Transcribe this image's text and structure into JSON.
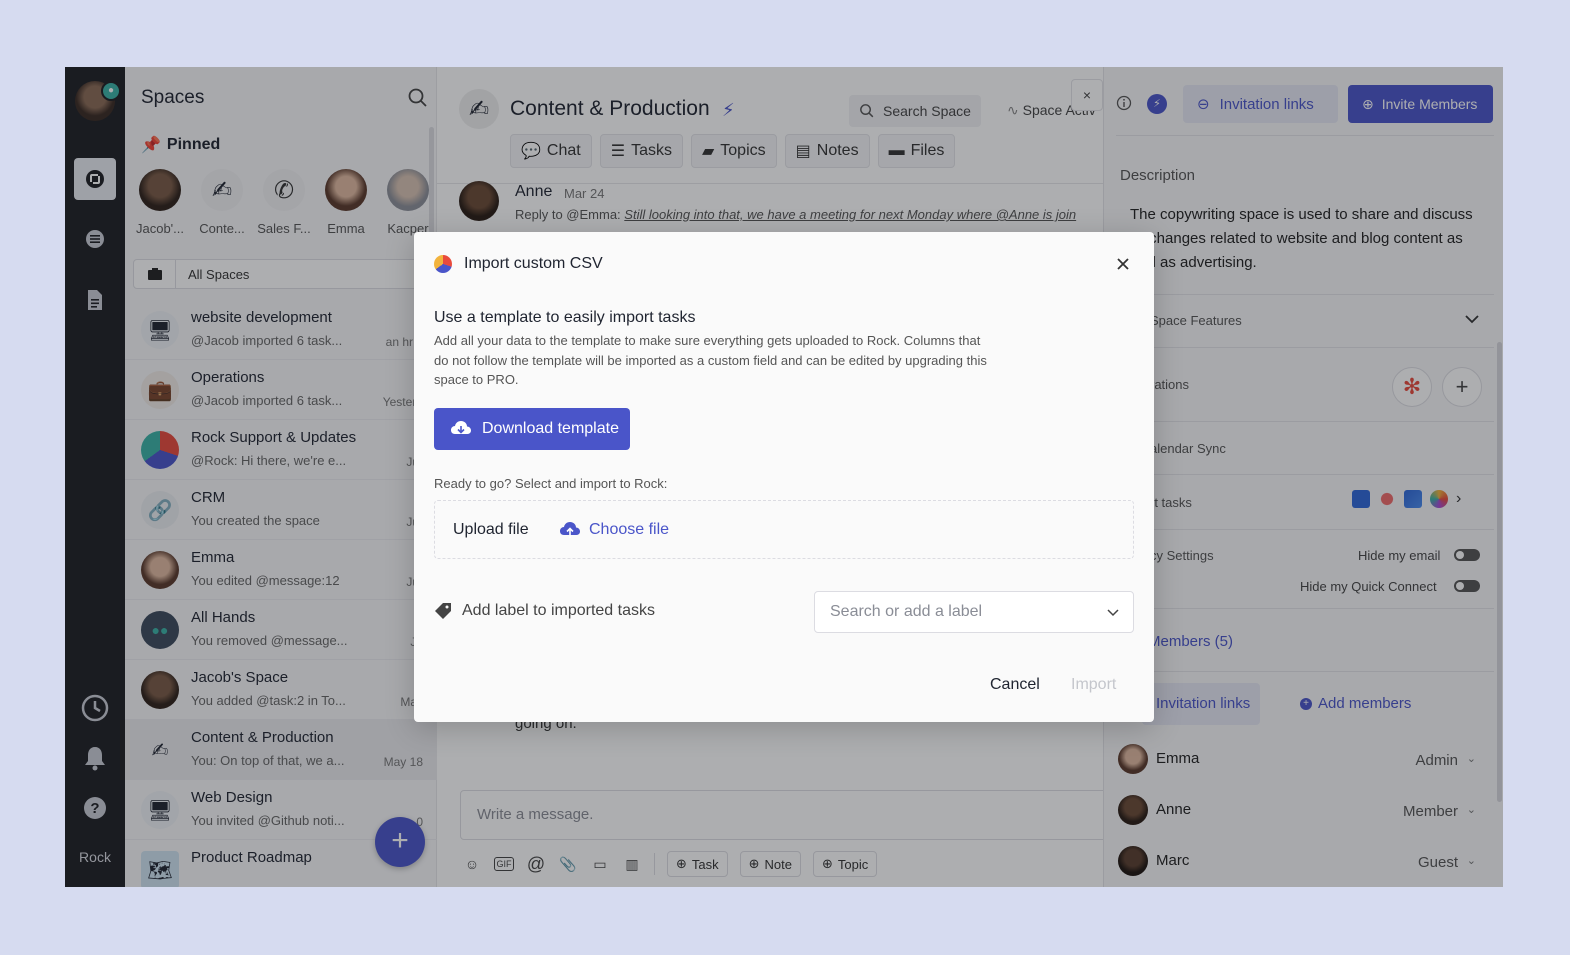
{
  "rail": {
    "label": "Rock"
  },
  "sidebar": {
    "title": "Spaces",
    "pinned_heading": "Pinned",
    "pins": [
      {
        "label": "Jacob'..."
      },
      {
        "label": "Conte..."
      },
      {
        "label": "Sales F..."
      },
      {
        "label": "Emma"
      },
      {
        "label": "Kacper"
      }
    ],
    "filter": "All Spaces",
    "spaces": [
      {
        "name": "website development",
        "sub": "@Jacob imported 6 task...",
        "time": "an hr a"
      },
      {
        "name": "Operations",
        "sub": "@Jacob imported 6 task...",
        "time": "Yesterd"
      },
      {
        "name": "Rock Support & Updates",
        "sub": "@Rock: Hi there, we're e...",
        "time": "Jur"
      },
      {
        "name": "CRM",
        "sub": "You created the space",
        "time": "Jur"
      },
      {
        "name": "Emma",
        "sub": "You edited @message:12",
        "time": "Jur"
      },
      {
        "name": "All Hands",
        "sub": "You removed @message...",
        "time": "Ju"
      },
      {
        "name": "Jacob's Space",
        "sub": "You added @task:2 in To...",
        "time": "May"
      },
      {
        "name": "Content & Production",
        "sub": "You: On top of that, we a...",
        "time": "May 18"
      },
      {
        "name": "Web Design",
        "sub": "You invited @Github noti...",
        "time": "0"
      },
      {
        "name": "Product Roadmap",
        "sub": "",
        "time": ""
      }
    ],
    "fab": "+"
  },
  "main": {
    "title": "Content & Production",
    "search_label": "Search Space",
    "activity_label": "Space Activ",
    "close": "×",
    "tabs": [
      {
        "label": "Chat"
      },
      {
        "label": "Tasks"
      },
      {
        "label": "Topics"
      },
      {
        "label": "Notes"
      },
      {
        "label": "Files"
      }
    ],
    "message": {
      "author": "Anne",
      "date": "Mar 24",
      "reply_prefix": "Reply to @Emma:",
      "reply_text": "Still looking into that, we have a meeting for next Monday where @Anne is join",
      "tail_text": "going on."
    },
    "composer_placeholder": "Write a message.",
    "tools": {
      "task": "Task",
      "note": "Note",
      "topic": "Topic"
    }
  },
  "right": {
    "invitation_links": "Invitation links",
    "invite_members": "Invite Members",
    "description_heading": "Description",
    "description": "The copywriting space is used to share and discuss all changes related to website and blog content as well as advertising.",
    "space_features": "Space Features",
    "integrations": "rations",
    "calendar_sync": "alendar Sync",
    "import_tasks": "rt tasks",
    "privacy_settings": "cy Settings",
    "hide_email": "Hide my email",
    "hide_quick_connect": "Hide my Quick Connect",
    "members_heading": "Members (5)",
    "invitation_links_2": "Invitation links",
    "add_members": "Add members",
    "members": [
      {
        "name": "Emma",
        "role": "Admin"
      },
      {
        "name": "Anne",
        "role": "Member"
      },
      {
        "name": "Marc",
        "role": "Guest"
      }
    ]
  },
  "modal": {
    "title": "Import custom CSV",
    "heading": "Use a template to easily import tasks",
    "body": "Add all your data to the template to make sure everything gets uploaded to Rock. Columns that do not follow the template will be imported as a custom field and can be edited by upgrading this space to PRO.",
    "download_label": "Download template",
    "ready_text": "Ready to go? Select and import to Rock:",
    "upload_label": "Upload file",
    "choose_label": "Choose file",
    "label_row": "Add label to imported tasks",
    "label_placeholder": "Search or add a label",
    "cancel": "Cancel",
    "import": "Import"
  },
  "colors": {
    "accent": "#4a55c9",
    "background": "#d6dbf0"
  }
}
